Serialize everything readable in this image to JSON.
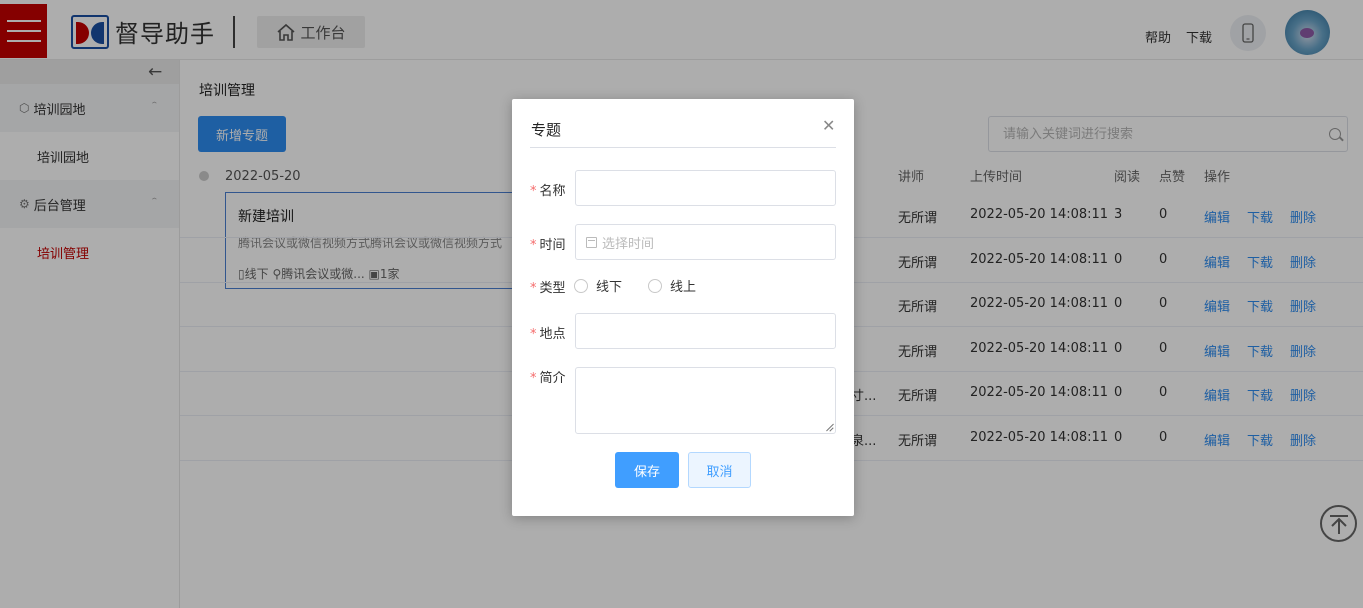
{
  "header": {
    "logo_text": "督导助手",
    "workbench_label": "工作台",
    "help_label": "帮助",
    "download_label": "下载"
  },
  "sidebar": {
    "groups": [
      {
        "label": "培训园地",
        "items": [
          {
            "label": "培训园地",
            "active": false
          }
        ]
      },
      {
        "label": "后台管理",
        "items": [
          {
            "label": "培训管理",
            "active": true
          }
        ]
      }
    ]
  },
  "main": {
    "page_title": "培训管理",
    "add_button": "新增专题",
    "search_placeholder": "请输入关键词进行搜索",
    "timeline_date": "2022-05-20",
    "card": {
      "title": "新建培训",
      "description": "腾讯会议或微信视频方式腾讯会议或微信视频方式",
      "mode": "线下",
      "location": "腾讯会议或微...",
      "count": "1家"
    },
    "table": {
      "headers": {
        "lecturer": "讲师",
        "upload_time": "上传时间",
        "reads": "阅读",
        "likes": "点赞",
        "ops": "操作"
      },
      "rows": [
        {
          "truncated": "",
          "lecturer": "无所谓",
          "upload_time": "2022-05-20 14:08:11",
          "reads": "3",
          "likes": "0"
        },
        {
          "truncated": "",
          "lecturer": "无所谓",
          "upload_time": "2022-05-20 14:08:11",
          "reads": "0",
          "likes": "0"
        },
        {
          "truncated": "",
          "lecturer": "无所谓",
          "upload_time": "2022-05-20 14:08:11",
          "reads": "0",
          "likes": "0"
        },
        {
          "truncated": "",
          "lecturer": "无所谓",
          "upload_time": "2022-05-20 14:08:11",
          "reads": "0",
          "likes": "0"
        },
        {
          "truncated": "寸...",
          "lecturer": "无所谓",
          "upload_time": "2022-05-20 14:08:11",
          "reads": "0",
          "likes": "0"
        },
        {
          "truncated": "泉...",
          "lecturer": "无所谓",
          "upload_time": "2022-05-20 14:08:11",
          "reads": "0",
          "likes": "0"
        }
      ],
      "op_edit": "编辑",
      "op_download": "下载",
      "op_delete": "删除"
    }
  },
  "dialog": {
    "title": "专题",
    "required_mark": "*",
    "name_label": "名称",
    "time_label": "时间",
    "time_placeholder": "选择时间",
    "type_label": "类型",
    "type_options": [
      "线下",
      "线上"
    ],
    "location_label": "地点",
    "intro_label": "简介",
    "save_label": "保存",
    "cancel_label": "取消"
  },
  "colors": {
    "brand_red": "#c40000",
    "primary_blue": "#409eff",
    "required_red": "#f56c6c"
  }
}
